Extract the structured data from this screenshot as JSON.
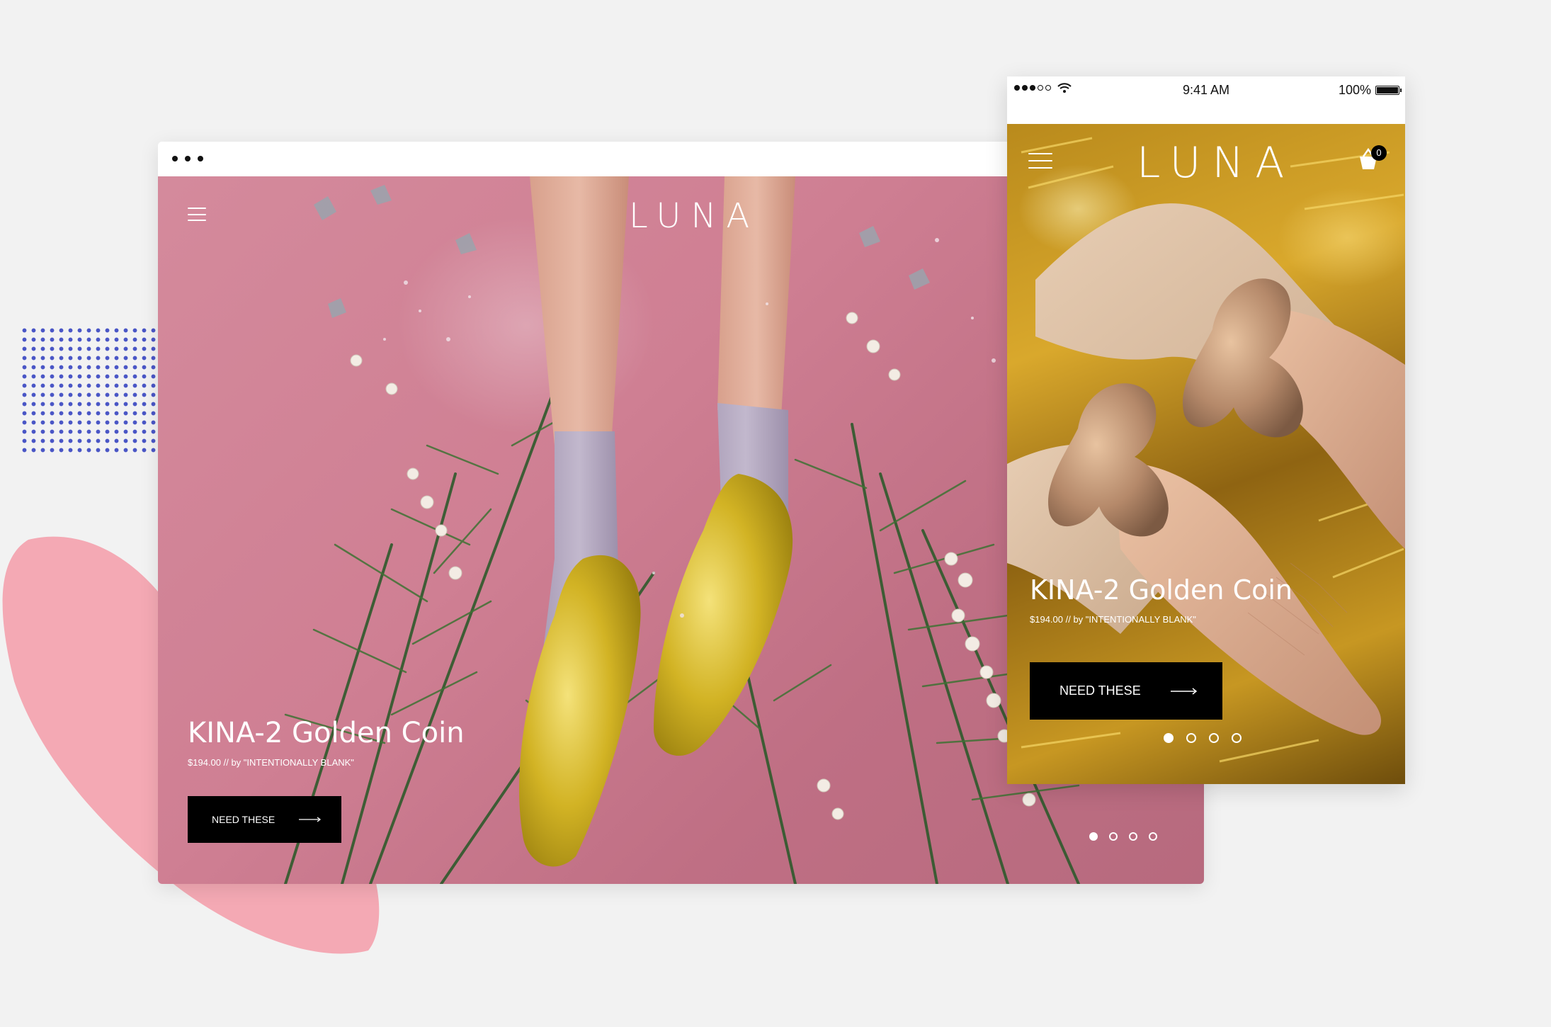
{
  "brand": {
    "logo_text": "LUNA"
  },
  "desktop": {
    "product_title": "KINA-2 Golden Coin",
    "product_subtitle": "$194.00 // by \"INTENTIONALLY BLANK\"",
    "cta_label": "NEED THESE",
    "slides": {
      "count": 4,
      "active": 1
    }
  },
  "mobile": {
    "status": {
      "time": "9:41 AM",
      "battery": "100%",
      "signal_bars": 3,
      "signal_total": 5
    },
    "cart_count": "0",
    "product_title": "KINA-2 Golden Coin",
    "product_subtitle": "$194.00 // by \"INTENTIONALLY BLANK\"",
    "cta_label": "NEED THESE",
    "slides": {
      "count": 4,
      "active": 1
    }
  },
  "colors": {
    "background": "#f2f2f2",
    "desktop_hero": "#cf7f93",
    "mobile_hero": "#d9a82c",
    "cta": "#000000",
    "dot_pattern": "#4a56c6",
    "blob": "#f4a9b4"
  }
}
